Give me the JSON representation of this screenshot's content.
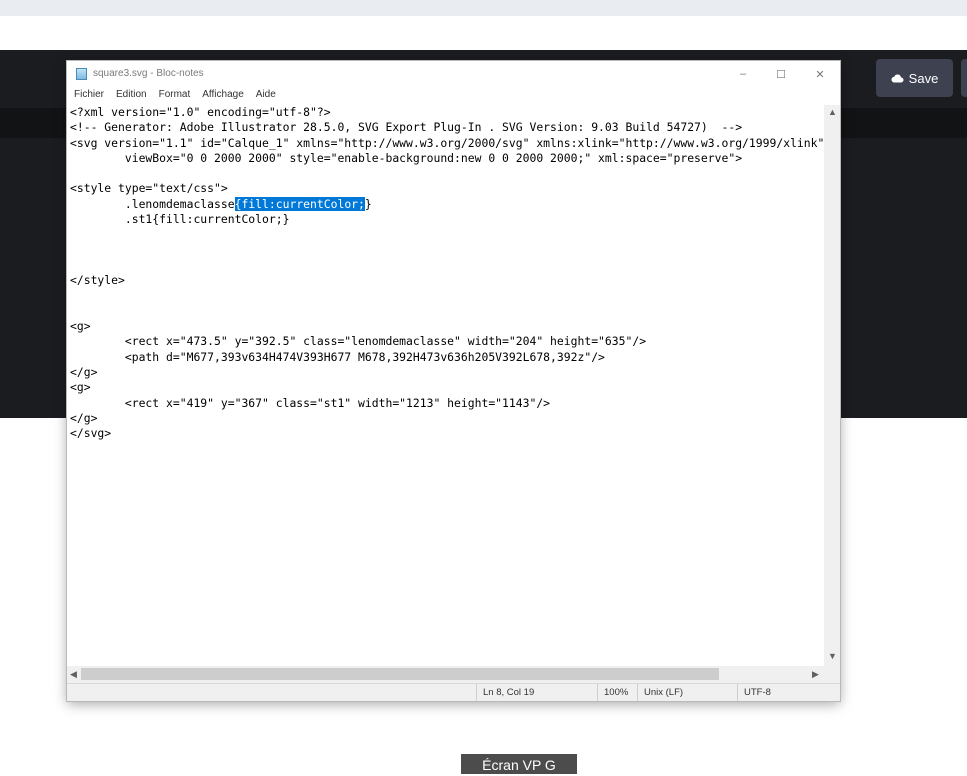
{
  "background_app": {
    "save_button_label": "Save",
    "caption": "Écran VP G"
  },
  "notepad": {
    "title": "square3.svg - Bloc-notes",
    "menu": [
      "Fichier",
      "Edition",
      "Format",
      "Affichage",
      "Aide"
    ],
    "window_controls": {
      "minimize": "–",
      "maximize": "☐",
      "close": "✕"
    },
    "selection": {
      "line_index": 6,
      "before": "        .lenomdemaclasse",
      "selected": "{fill:currentColor;",
      "after": "}"
    },
    "lines": [
      "<?xml version=\"1.0\" encoding=\"utf-8\"?>",
      "<!-- Generator: Adobe Illustrator 28.5.0, SVG Export Plug-In . SVG Version: 9.03 Build 54727)  -->",
      "<svg version=\"1.1\" id=\"Calque_1\" xmlns=\"http://www.w3.org/2000/svg\" xmlns:xlink=\"http://www.w3.org/1999/xlink\"",
      "        viewBox=\"0 0 2000 2000\" style=\"enable-background:new 0 0 2000 2000;\" xml:space=\"preserve\">",
      "",
      "<style type=\"text/css\">",
      "        .lenomdemaclasse{fill:currentColor;}",
      "        .st1{fill:currentColor;}",
      "",
      "",
      "",
      "</style>",
      "",
      "",
      "<g>",
      "        <rect x=\"473.5\" y=\"392.5\" class=\"lenomdemaclasse\" width=\"204\" height=\"635\"/>",
      "        <path d=\"M677,393v634H474V393H677 M678,392H473v636h205V392L678,392z\"/>",
      "</g>",
      "<g>",
      "        <rect x=\"419\" y=\"367\" class=\"st1\" width=\"1213\" height=\"1143\"/>",
      "</g>",
      "</svg>"
    ],
    "status": {
      "position": "Ln 8, Col 19",
      "zoom": "100%",
      "line_ending": "Unix (LF)",
      "encoding": "UTF-8"
    }
  }
}
